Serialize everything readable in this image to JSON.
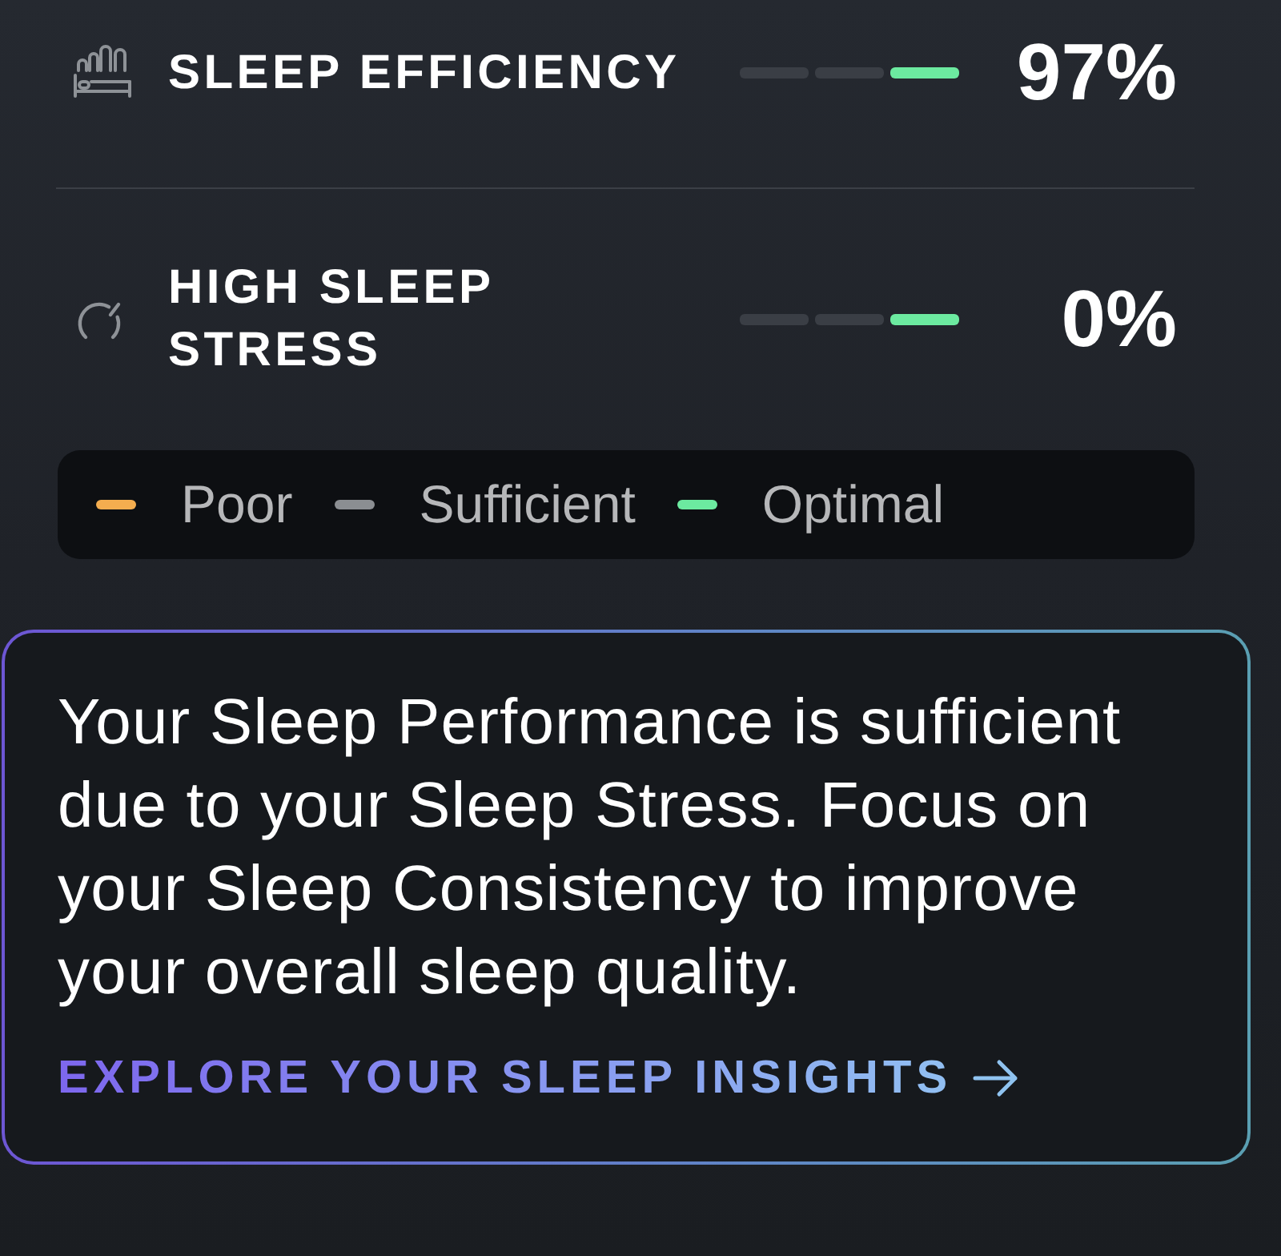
{
  "metrics": [
    {
      "title": "SLEEP EFFICIENCY",
      "value": "97%",
      "segments": [
        {
          "lit": false
        },
        {
          "lit": false
        },
        {
          "lit": true
        }
      ]
    },
    {
      "title": "HIGH SLEEP STRESS",
      "value": "0%",
      "segments": [
        {
          "lit": false
        },
        {
          "lit": false
        },
        {
          "lit": true
        }
      ]
    }
  ],
  "legend": {
    "items": [
      {
        "label": "Poor",
        "color": "#f4ad4f"
      },
      {
        "label": "Sufficient",
        "color": "#8b8e92"
      },
      {
        "label": "Optimal",
        "color": "#6ceaa0"
      }
    ]
  },
  "insight": {
    "message": "Your Sleep Performance is sufficient due to your Sleep Stress. Focus on your Sleep Consistency to improve your overall sleep quality.",
    "link": "EXPLORE YOUR SLEEP INSIGHTS"
  }
}
